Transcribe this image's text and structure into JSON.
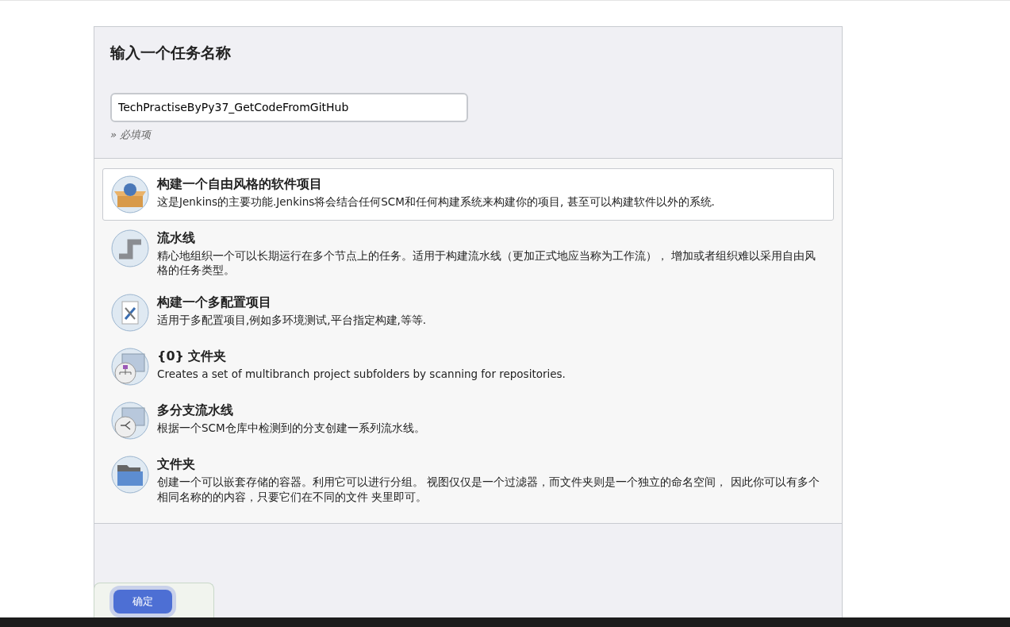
{
  "header": {
    "title": "输入一个任务名称",
    "name_field": {
      "value": "TechPractiseByPy37_GetCodeFromGitHub"
    },
    "hint": "» 必填项"
  },
  "items": [
    {
      "kind": "freestyle",
      "title": "构建一个自由风格的软件项目",
      "description": "这是Jenkins的主要功能.Jenkins将会结合任何SCM和任何构建系统来构建你的项目, 甚至可以构建软件以外的系统.",
      "selected": true
    },
    {
      "kind": "pipeline",
      "title": "流水线",
      "description": "精心地组织一个可以长期运行在多个节点上的任务。适用于构建流水线（更加正式地应当称为工作流）， 增加或者组织难以采用自由风格的任务类型。",
      "selected": false
    },
    {
      "kind": "multiconfig",
      "title": "构建一个多配置项目",
      "description": "适用于多配置项目,例如多环境测试,平台指定构建,等等.",
      "selected": false
    },
    {
      "kind": "orgfolder",
      "title": "{0} 文件夹",
      "description": "Creates a set of multibranch project subfolders by scanning for repositories.",
      "selected": false
    },
    {
      "kind": "multibranch",
      "title": "多分支流水线",
      "description": "根据一个SCM仓库中检测到的分支创建一系列流水线。",
      "selected": false
    },
    {
      "kind": "folder",
      "title": "文件夹",
      "description": "创建一个可以嵌套存储的容器。利用它可以进行分组。 视图仅仅是一个过滤器，而文件夹则是一个独立的命名空间， 因此你可以有多个相同名称的的内容，只要它们在不同的文件 夹里即可。",
      "selected": false
    }
  ],
  "footer": {
    "ok_button": "确定"
  }
}
